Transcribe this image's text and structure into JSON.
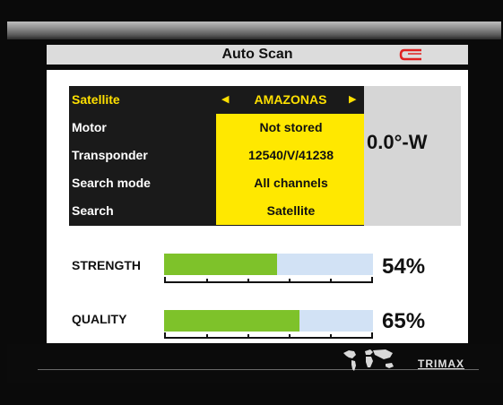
{
  "window": {
    "title": "Auto Scan"
  },
  "menu": {
    "rows": [
      {
        "label": "Satellite",
        "value": "AMAZONAS"
      },
      {
        "label": "Motor",
        "value": "Not stored"
      },
      {
        "label": "Transponder",
        "value": "12540/V/41238"
      },
      {
        "label": "Search mode",
        "value": "All channels"
      },
      {
        "label": "Search",
        "value": "Satellite"
      }
    ],
    "selected_row": 0
  },
  "position": {
    "value": "0.0°-W"
  },
  "meters": {
    "strength": {
      "label": "STRENGTH",
      "percent_text": "54%",
      "level": 0.54
    },
    "quality": {
      "label": "QUALITY",
      "percent_text": "65%",
      "level": 0.65
    }
  },
  "brand": {
    "name": "TRIMAX"
  },
  "colors": {
    "highlight": "#ffe800",
    "meter_fill": "#7ec22a",
    "meter_track": "#d2e2f5",
    "signal_icon": "#e02020"
  },
  "icons": {
    "signal": "signal-wave-icon",
    "map": "world-map-icon",
    "left": "triangle-left-icon",
    "right": "triangle-right-icon"
  }
}
